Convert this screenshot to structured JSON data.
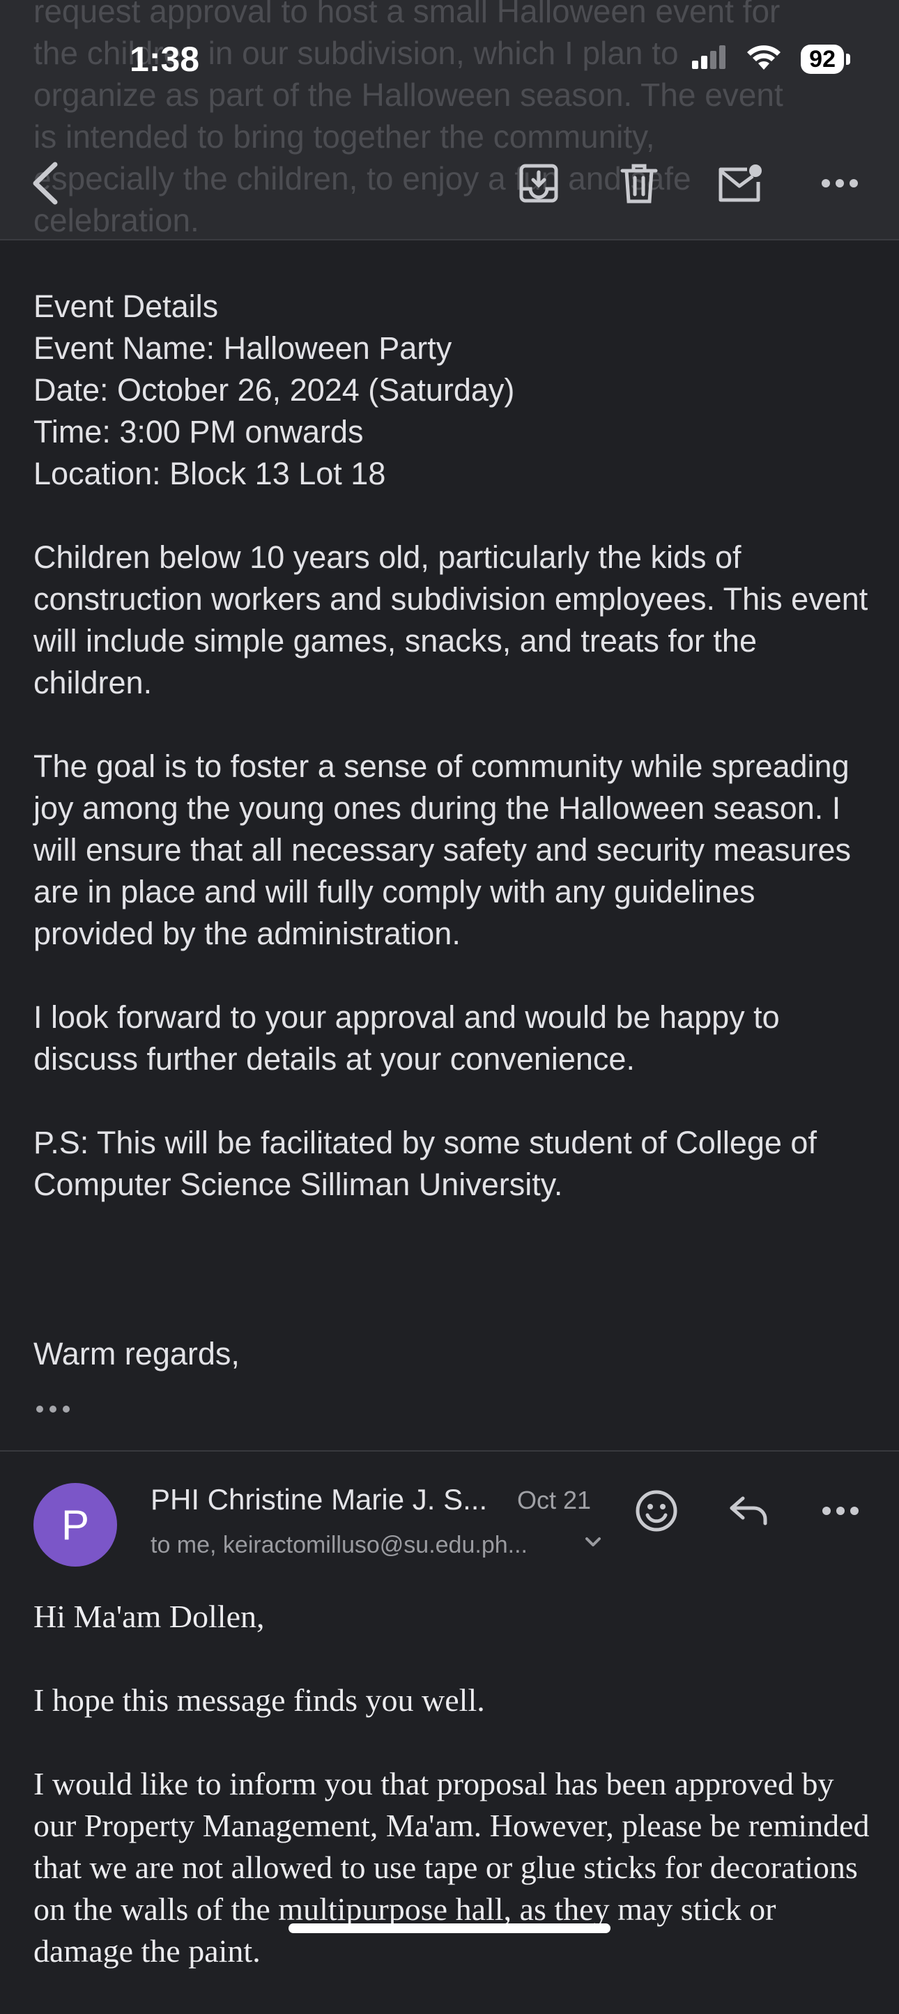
{
  "status": {
    "time": "1:38",
    "battery": "92"
  },
  "ghost_text": "request approval to host a small Halloween event for\nthe children in our subdivision, which I plan to\norganize as part of the Halloween season. The event\nis intended to bring together the community,\nespecially the children, to enjoy a fun and safe\ncelebration.",
  "toolbar": {
    "back_icon": "chevron-left-icon",
    "archive_icon": "archive-icon",
    "delete_icon": "trash-icon",
    "mark_unread_icon": "mail-unread-icon",
    "more_icon": "more-horizontal-icon"
  },
  "message1": {
    "paragraphs": [
      "Event Details\nEvent Name: Halloween Party\nDate: October 26, 2024 (Saturday)\nTime: 3:00 PM onwards\nLocation: Block 13 Lot 18",
      "Children below 10 years old, particularly the kids of construction workers and subdivision employees. This event will include simple games, snacks, and treats for the children.",
      "The goal is to foster a sense of community while spreading joy among the young ones during the Halloween season. I will ensure that all necessary safety and security measures are in place and will fully comply with any guidelines provided by the administration.",
      " I look forward to your approval and would be happy to discuss further details at your convenience.",
      "P.S: This will be facilitated by some student of College of Computer Science Silliman University."
    ],
    "signoff": "Warm regards,"
  },
  "message2": {
    "avatar_letter": "P",
    "avatar_color": "#7b56c8",
    "sender": "PHI Christine Marie J. S...",
    "date": "Oct 21",
    "recipients": "to me, keiractomilluso@su.edu.ph...",
    "paragraphs": [
      "Hi Ma'am Dollen,",
      "I hope this message finds you well.",
      "I would like to inform you that proposal has been approved by our Property Management, Ma'am. However, please be reminded that we are not allowed to use tape or glue sticks for decorations on the walls of the multipurpose hall, as they may stick or damage the paint."
    ]
  }
}
